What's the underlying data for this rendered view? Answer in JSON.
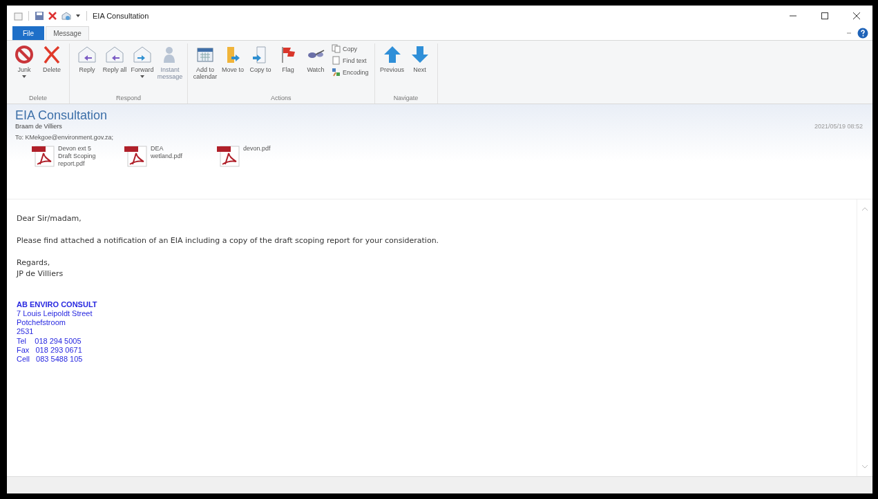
{
  "window": {
    "title": "EIA Consultation"
  },
  "tabs": [
    {
      "label": "File",
      "kind": "file",
      "selected": false
    },
    {
      "label": "Message",
      "kind": "tab",
      "selected": true
    }
  ],
  "ribbon": [
    {
      "label": "Delete",
      "buttons": [
        {
          "label": "Junk",
          "kind": "junk",
          "dropdown": true,
          "disabled": false
        },
        {
          "label": "Delete",
          "kind": "delete",
          "dropdown": false,
          "disabled": false
        }
      ]
    },
    {
      "label": "Respond",
      "buttons": [
        {
          "label": "Reply",
          "kind": "reply",
          "dropdown": false,
          "disabled": false
        },
        {
          "label": "Reply all",
          "kind": "replyall",
          "dropdown": false,
          "disabled": false
        },
        {
          "label": "Forward",
          "kind": "forward",
          "dropdown": true,
          "disabled": false
        },
        {
          "label": "Instant message",
          "kind": "person",
          "dropdown": false,
          "disabled": true
        }
      ]
    },
    {
      "label": "Actions",
      "buttons": [
        {
          "label": "Add to calendar",
          "kind": "calendar",
          "dropdown": false,
          "disabled": false
        },
        {
          "label": "Move to",
          "kind": "move",
          "dropdown": false,
          "disabled": false
        },
        {
          "label": "Copy to",
          "kind": "copyto",
          "dropdown": false,
          "disabled": false
        },
        {
          "label": "Flag",
          "kind": "flag",
          "dropdown": false,
          "disabled": false
        },
        {
          "label": "Watch",
          "kind": "watch",
          "dropdown": false,
          "disabled": false
        }
      ],
      "small": [
        {
          "label": "Copy",
          "kind": "copy"
        },
        {
          "label": "Find text",
          "kind": "find"
        },
        {
          "label": "Encoding",
          "kind": "encoding"
        }
      ]
    },
    {
      "label": "Navigate",
      "buttons": [
        {
          "label": "Previous",
          "kind": "up",
          "dropdown": false,
          "disabled": false
        },
        {
          "label": "Next",
          "kind": "down",
          "dropdown": false,
          "disabled": false
        }
      ]
    }
  ],
  "message": {
    "subject": "EIA Consultation",
    "sender": "Braam de Villiers",
    "date": "2021/05/19 08:52",
    "to_label": "To:",
    "to": "KMekgoe@environment.gov.za;",
    "attachments": [
      "Devon ext 5 Draft Scoping report.pdf",
      "DEA wetland.pdf",
      "devon.pdf"
    ],
    "body": [
      "Dear Sir/madam,",
      "Please find attached a notification of an EIA including a copy of the draft scoping report for your consideration.",
      "Regards,\nJP de Villiers"
    ],
    "signature": {
      "company": "AB ENVIRO CONSULT",
      "lines": [
        "7 Louis Leipoldt Street",
        "Potchefstroom",
        "2531",
        "Tel    018 294 5005",
        "Fax   018 293 0671",
        "Cell   083 5488 105"
      ]
    }
  }
}
